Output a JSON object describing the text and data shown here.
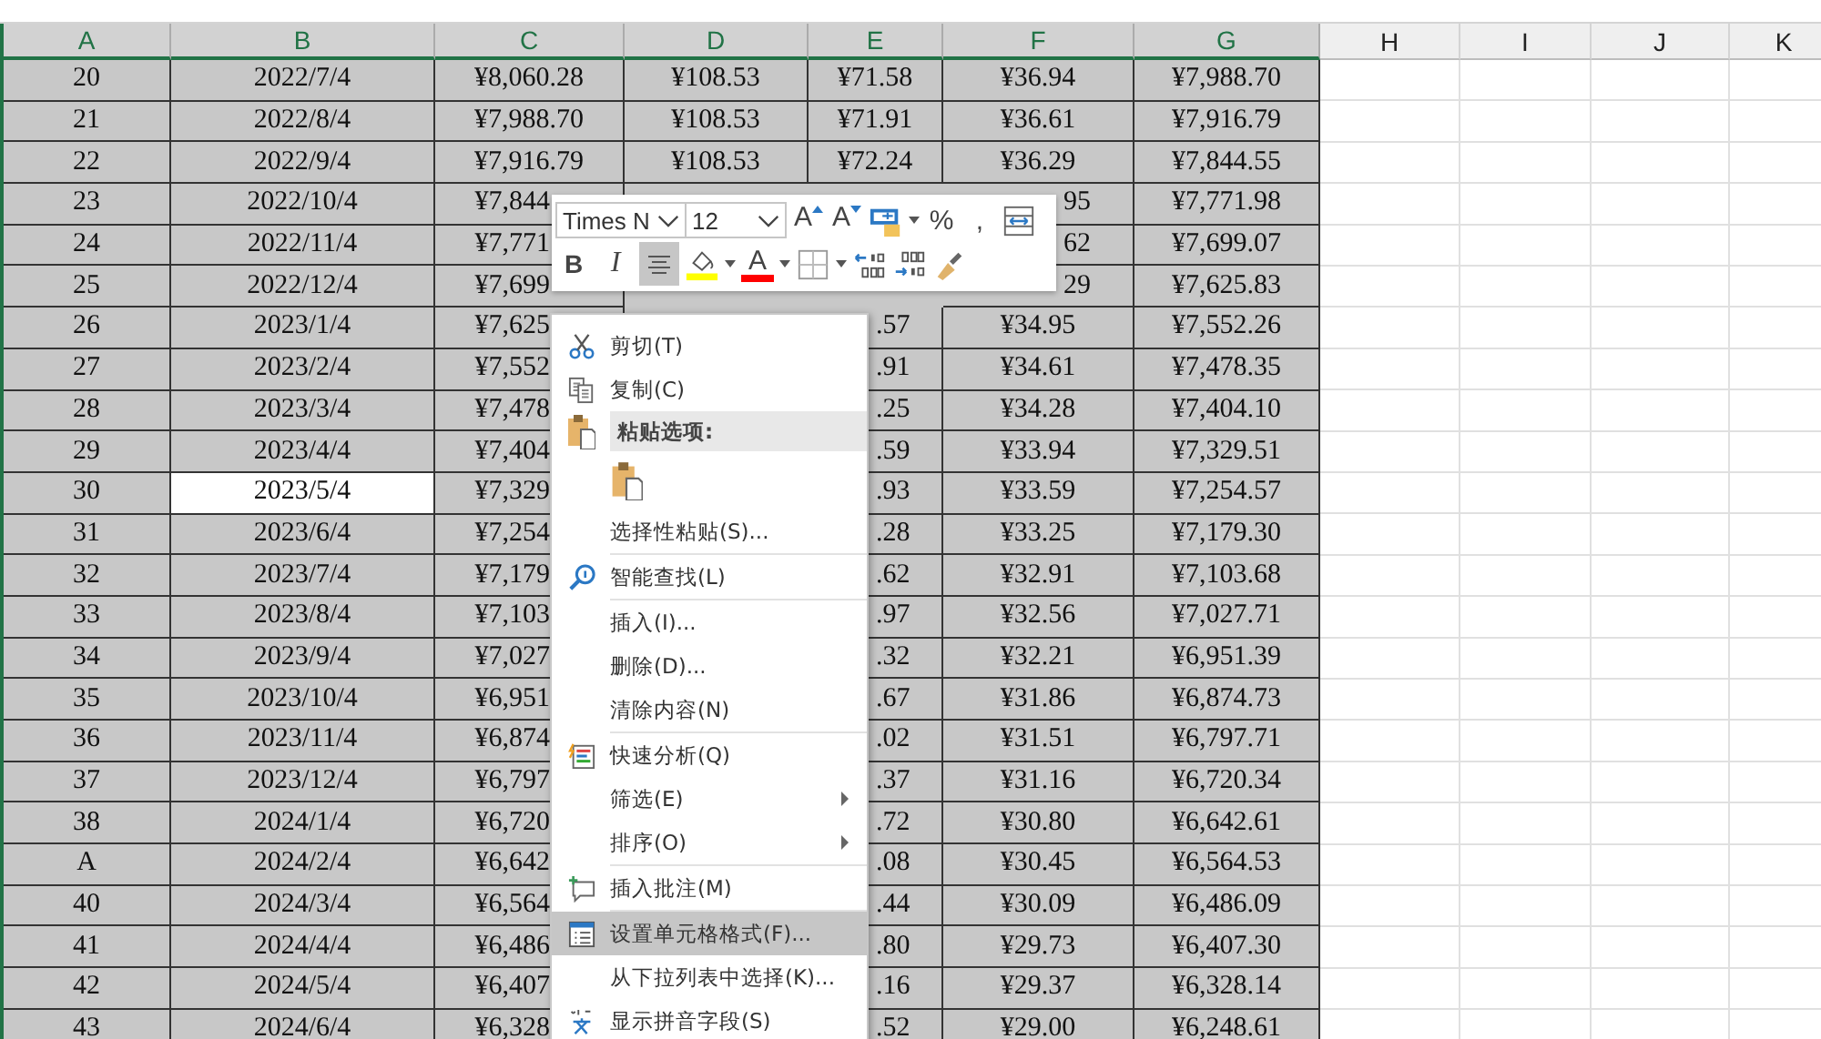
{
  "columns": [
    {
      "label": "A",
      "selected": true
    },
    {
      "label": "B",
      "selected": true
    },
    {
      "label": "C",
      "selected": true
    },
    {
      "label": "D",
      "selected": true
    },
    {
      "label": "E",
      "selected": true
    },
    {
      "label": "F",
      "selected": true
    },
    {
      "label": "G",
      "selected": true
    },
    {
      "label": "H",
      "selected": false
    },
    {
      "label": "I",
      "selected": false
    },
    {
      "label": "J",
      "selected": false
    },
    {
      "label": "K",
      "selected": false
    }
  ],
  "rows": [
    {
      "cells": [
        {
          "text": "20",
          "active": false
        },
        {
          "text": "2022/7/4",
          "active": false
        },
        {
          "text": "¥8,060.28",
          "active": false
        },
        {
          "text": "¥108.53",
          "active": false
        },
        {
          "text": "¥71.58",
          "active": false
        },
        {
          "text": "¥36.94",
          "active": false
        },
        {
          "text": "¥7,988.70",
          "active": false
        }
      ]
    },
    {
      "cells": [
        {
          "text": "21",
          "active": false
        },
        {
          "text": "2022/8/4",
          "active": false
        },
        {
          "text": "¥7,988.70",
          "active": false
        },
        {
          "text": "¥108.53",
          "active": false
        },
        {
          "text": "¥71.91",
          "active": false
        },
        {
          "text": "¥36.61",
          "active": false
        },
        {
          "text": "¥7,916.79",
          "active": false
        }
      ]
    },
    {
      "cells": [
        {
          "text": "22",
          "active": false
        },
        {
          "text": "2022/9/4",
          "active": false
        },
        {
          "text": "¥7,916.79",
          "active": false
        },
        {
          "text": "¥108.53",
          "active": false
        },
        {
          "text": "¥72.24",
          "active": false
        },
        {
          "text": "¥36.29",
          "active": false
        },
        {
          "text": "¥7,844.55",
          "active": false
        }
      ]
    },
    {
      "cells": [
        {
          "text": "23",
          "active": false
        },
        {
          "text": "2022/10/4",
          "active": false
        },
        {
          "text": "¥7,844",
          "active": false
        },
        null,
        null,
        {
          "text": "95",
          "active": false
        },
        {
          "text": "¥7,771.98",
          "active": false
        }
      ]
    },
    {
      "cells": [
        {
          "text": "24",
          "active": false
        },
        {
          "text": "2022/11/4",
          "active": false
        },
        {
          "text": "¥7,771",
          "active": false
        },
        null,
        null,
        {
          "text": "62",
          "active": false
        },
        {
          "text": "¥7,699.07",
          "active": false
        }
      ]
    },
    {
      "cells": [
        {
          "text": "25",
          "active": false
        },
        {
          "text": "2022/12/4",
          "active": false
        },
        {
          "text": "¥7,699",
          "active": false
        },
        null,
        null,
        {
          "text": "29",
          "active": false
        },
        {
          "text": "¥7,625.83",
          "active": false
        }
      ]
    },
    {
      "cells": [
        {
          "text": "26",
          "active": false
        },
        {
          "text": "2023/1/4",
          "active": false
        },
        {
          "text": "¥7,625",
          "active": false
        },
        null,
        {
          "text": ".57",
          "active": false
        },
        {
          "text": "¥34.95",
          "active": false
        },
        {
          "text": "¥7,552.26",
          "active": false
        }
      ]
    },
    {
      "cells": [
        {
          "text": "27",
          "active": false
        },
        {
          "text": "2023/2/4",
          "active": false
        },
        {
          "text": "¥7,552",
          "active": false
        },
        null,
        {
          "text": ".91",
          "active": false
        },
        {
          "text": "¥34.61",
          "active": false
        },
        {
          "text": "¥7,478.35",
          "active": false
        }
      ]
    },
    {
      "cells": [
        {
          "text": "28",
          "active": false
        },
        {
          "text": "2023/3/4",
          "active": false
        },
        {
          "text": "¥7,478",
          "active": false
        },
        null,
        {
          "text": ".25",
          "active": false
        },
        {
          "text": "¥34.28",
          "active": false
        },
        {
          "text": "¥7,404.10",
          "active": false
        }
      ]
    },
    {
      "cells": [
        {
          "text": "29",
          "active": false
        },
        {
          "text": "2023/4/4",
          "active": false
        },
        {
          "text": "¥7,404",
          "active": false
        },
        null,
        {
          "text": ".59",
          "active": false
        },
        {
          "text": "¥33.94",
          "active": false
        },
        {
          "text": "¥7,329.51",
          "active": false
        }
      ]
    },
    {
      "cells": [
        {
          "text": "30",
          "active": false
        },
        {
          "text": "2023/5/4",
          "active": true
        },
        {
          "text": "¥7,329",
          "active": false
        },
        null,
        {
          "text": ".93",
          "active": false
        },
        {
          "text": "¥33.59",
          "active": false
        },
        {
          "text": "¥7,254.57",
          "active": false
        }
      ]
    },
    {
      "cells": [
        {
          "text": "31",
          "active": false
        },
        {
          "text": "2023/6/4",
          "active": false
        },
        {
          "text": "¥7,254",
          "active": false
        },
        null,
        {
          "text": ".28",
          "active": false
        },
        {
          "text": "¥33.25",
          "active": false
        },
        {
          "text": "¥7,179.30",
          "active": false
        }
      ]
    },
    {
      "cells": [
        {
          "text": "32",
          "active": false
        },
        {
          "text": "2023/7/4",
          "active": false
        },
        {
          "text": "¥7,179",
          "active": false
        },
        null,
        {
          "text": ".62",
          "active": false
        },
        {
          "text": "¥32.91",
          "active": false
        },
        {
          "text": "¥7,103.68",
          "active": false
        }
      ]
    },
    {
      "cells": [
        {
          "text": "33",
          "active": false
        },
        {
          "text": "2023/8/4",
          "active": false
        },
        {
          "text": "¥7,103",
          "active": false
        },
        null,
        {
          "text": ".97",
          "active": false
        },
        {
          "text": "¥32.56",
          "active": false
        },
        {
          "text": "¥7,027.71",
          "active": false
        }
      ]
    },
    {
      "cells": [
        {
          "text": "34",
          "active": false
        },
        {
          "text": "2023/9/4",
          "active": false
        },
        {
          "text": "¥7,027",
          "active": false
        },
        null,
        {
          "text": ".32",
          "active": false
        },
        {
          "text": "¥32.21",
          "active": false
        },
        {
          "text": "¥6,951.39",
          "active": false
        }
      ]
    },
    {
      "cells": [
        {
          "text": "35",
          "active": false
        },
        {
          "text": "2023/10/4",
          "active": false
        },
        {
          "text": "¥6,951",
          "active": false
        },
        null,
        {
          "text": ".67",
          "active": false
        },
        {
          "text": "¥31.86",
          "active": false
        },
        {
          "text": "¥6,874.73",
          "active": false
        }
      ]
    },
    {
      "cells": [
        {
          "text": "36",
          "active": false
        },
        {
          "text": "2023/11/4",
          "active": false
        },
        {
          "text": "¥6,874",
          "active": false
        },
        null,
        {
          "text": ".02",
          "active": false
        },
        {
          "text": "¥31.51",
          "active": false
        },
        {
          "text": "¥6,797.71",
          "active": false
        }
      ]
    },
    {
      "cells": [
        {
          "text": "37",
          "active": false
        },
        {
          "text": "2023/12/4",
          "active": false
        },
        {
          "text": "¥6,797",
          "active": false
        },
        null,
        {
          "text": ".37",
          "active": false
        },
        {
          "text": "¥31.16",
          "active": false
        },
        {
          "text": "¥6,720.34",
          "active": false
        }
      ]
    },
    {
      "cells": [
        {
          "text": "38",
          "active": false
        },
        {
          "text": "2024/1/4",
          "active": false
        },
        {
          "text": "¥6,720",
          "active": false
        },
        null,
        {
          "text": ".72",
          "active": false
        },
        {
          "text": "¥30.80",
          "active": false
        },
        {
          "text": "¥6,642.61",
          "active": false
        }
      ]
    },
    {
      "cells": [
        {
          "text": "A",
          "active": false
        },
        {
          "text": "2024/2/4",
          "active": false
        },
        {
          "text": "¥6,642",
          "active": false
        },
        null,
        {
          "text": ".08",
          "active": false
        },
        {
          "text": "¥30.45",
          "active": false
        },
        {
          "text": "¥6,564.53",
          "active": false
        }
      ]
    },
    {
      "cells": [
        {
          "text": "40",
          "active": false
        },
        {
          "text": "2024/3/4",
          "active": false
        },
        {
          "text": "¥6,564",
          "active": false
        },
        null,
        {
          "text": ".44",
          "active": false
        },
        {
          "text": "¥30.09",
          "active": false
        },
        {
          "text": "¥6,486.09",
          "active": false
        }
      ]
    },
    {
      "cells": [
        {
          "text": "41",
          "active": false
        },
        {
          "text": "2024/4/4",
          "active": false
        },
        {
          "text": "¥6,486",
          "active": false
        },
        null,
        {
          "text": ".80",
          "active": false
        },
        {
          "text": "¥29.73",
          "active": false
        },
        {
          "text": "¥6,407.30",
          "active": false
        }
      ]
    },
    {
      "cells": [
        {
          "text": "42",
          "active": false
        },
        {
          "text": "2024/5/4",
          "active": false
        },
        {
          "text": "¥6,407",
          "active": false
        },
        null,
        {
          "text": ".16",
          "active": false
        },
        {
          "text": "¥29.37",
          "active": false
        },
        {
          "text": "¥6,328.14",
          "active": false
        }
      ]
    },
    {
      "cells": [
        {
          "text": "43",
          "active": false
        },
        {
          "text": "2024/6/4",
          "active": false
        },
        {
          "text": "¥6,328",
          "active": false
        },
        null,
        {
          "text": ".52",
          "active": false
        },
        {
          "text": "¥29.00",
          "active": false
        },
        {
          "text": "¥6,248.61",
          "active": false
        }
      ]
    }
  ],
  "mini_toolbar": {
    "font": {
      "value": "Times N"
    },
    "size": {
      "value": "12"
    },
    "row_1": [
      {
        "kind": "grow",
        "label": "A"
      },
      {
        "kind": "shrink",
        "label": "A"
      },
      {
        "kind": "format",
        "dropdown": true
      },
      {
        "kind": "char",
        "label": "%"
      },
      {
        "kind": "char",
        "label": ","
      },
      {
        "kind": "wrap"
      }
    ],
    "row_2": [
      {
        "kind": "bold",
        "label": "B",
        "selected": false
      },
      {
        "kind": "italic",
        "label": "I",
        "selected": false
      },
      {
        "kind": "center",
        "selected": true
      },
      {
        "kind": "fill",
        "color": "#ffff00",
        "dropdown": true
      },
      {
        "kind": "font-color",
        "label": "A",
        "color": "#ff0000",
        "dropdown": true
      },
      {
        "kind": "borders",
        "dropdown": true
      },
      {
        "kind": "inc-decimal"
      },
      {
        "kind": "dec-decimal"
      },
      {
        "kind": "painter"
      }
    ]
  },
  "context_menu": {
    "groups": [
      [
        {
          "kind": "item",
          "label": "剪切(T)",
          "selected": false,
          "submenu": false
        },
        {
          "kind": "item",
          "label": "复制(C)",
          "selected": false,
          "submenu": false
        },
        {
          "kind": "header",
          "label": "粘贴选项:"
        },
        {
          "kind": "paste-options"
        },
        {
          "kind": "item",
          "label": "选择性粘贴(S)...",
          "selected": false,
          "submenu": false
        }
      ],
      [
        {
          "kind": "item",
          "label": "智能查找(L)",
          "selected": false,
          "submenu": false
        }
      ],
      [
        {
          "kind": "item",
          "label": "插入(I)...",
          "selected": false,
          "submenu": false
        },
        {
          "kind": "item",
          "label": "删除(D)...",
          "selected": false,
          "submenu": false
        },
        {
          "kind": "item",
          "label": "清除内容(N)",
          "selected": false,
          "submenu": false
        }
      ],
      [
        {
          "kind": "item",
          "label": "快速分析(Q)",
          "selected": false,
          "submenu": false
        },
        {
          "kind": "item",
          "label": "筛选(E)",
          "selected": false,
          "submenu": true
        },
        {
          "kind": "item",
          "label": "排序(O)",
          "selected": false,
          "submenu": true
        }
      ],
      [
        {
          "kind": "item",
          "label": "插入批注(M)",
          "selected": false,
          "submenu": false
        }
      ],
      [
        {
          "kind": "item",
          "label": "设置单元格格式(F)...",
          "selected": true,
          "submenu": false
        },
        {
          "kind": "item",
          "label": "从下拉列表中选择(K)...",
          "selected": false,
          "submenu": false
        },
        {
          "kind": "item",
          "label": "显示拼音字段(S)",
          "selected": false,
          "submenu": false
        }
      ]
    ]
  }
}
